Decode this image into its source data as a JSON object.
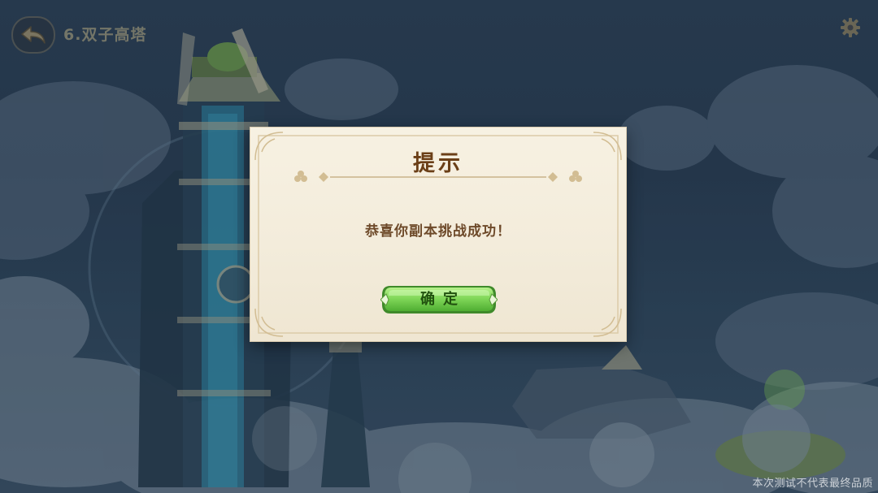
{
  "header": {
    "stage_title": "6.双子高塔",
    "back_icon": "back-arrow-icon",
    "settings_icon": "gear-icon"
  },
  "dialog": {
    "title": "提示",
    "message": "恭喜你副本挑战成功！",
    "confirm_label": "确定"
  },
  "footer": {
    "watermark": "本次测试不代表最终品质"
  },
  "colors": {
    "dialog_bg": "#f5eedf",
    "title_text": "#6b3f17",
    "message_text": "#6e4a2a",
    "confirm_green": "#7ed957",
    "confirm_text": "#21510f"
  }
}
